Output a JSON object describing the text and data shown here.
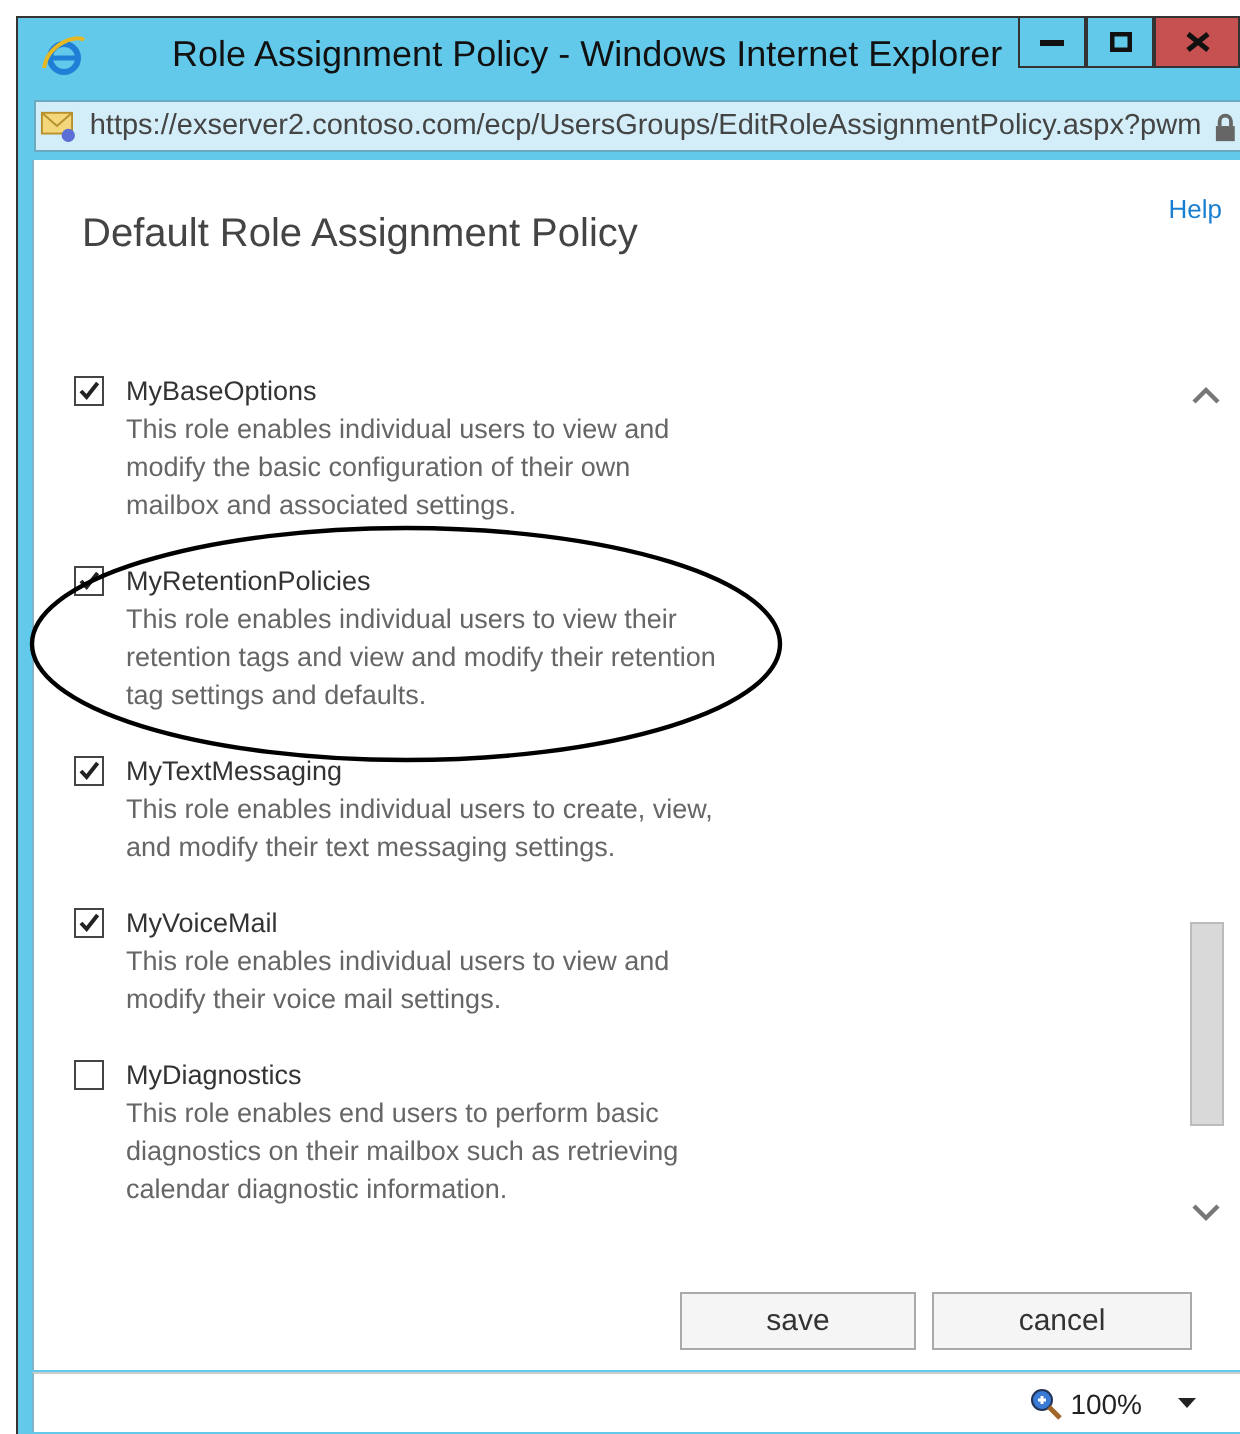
{
  "window": {
    "title": "Role Assignment Policy - Windows Internet Explorer"
  },
  "address_bar": {
    "url": "https://exserver2.contoso.com/ecp/UsersGroups/EditRoleAssignmentPolicy.aspx?pwm"
  },
  "help_link": "Help",
  "heading": "Default Role Assignment Policy",
  "roles": [
    {
      "name": "MyBaseOptions",
      "description": "This role enables individual users to view and modify the basic configuration of their own mailbox and associated settings.",
      "checked": true
    },
    {
      "name": "MyRetentionPolicies",
      "description": "This role enables individual users to view their retention tags and view and modify their retention tag settings and defaults.",
      "checked": true
    },
    {
      "name": "MyTextMessaging",
      "description": "This role enables individual users to create, view, and modify their text messaging settings.",
      "checked": true
    },
    {
      "name": "MyVoiceMail",
      "description": "This role enables individual users to view and modify their voice mail settings.",
      "checked": true
    },
    {
      "name": "MyDiagnostics",
      "description": "This role enables end users to perform basic diagnostics on their mailbox such as retrieving calendar diagnostic information.",
      "checked": false
    }
  ],
  "buttons": [
    "save",
    "cancel"
  ],
  "status_bar": {
    "zoom": "100%"
  }
}
